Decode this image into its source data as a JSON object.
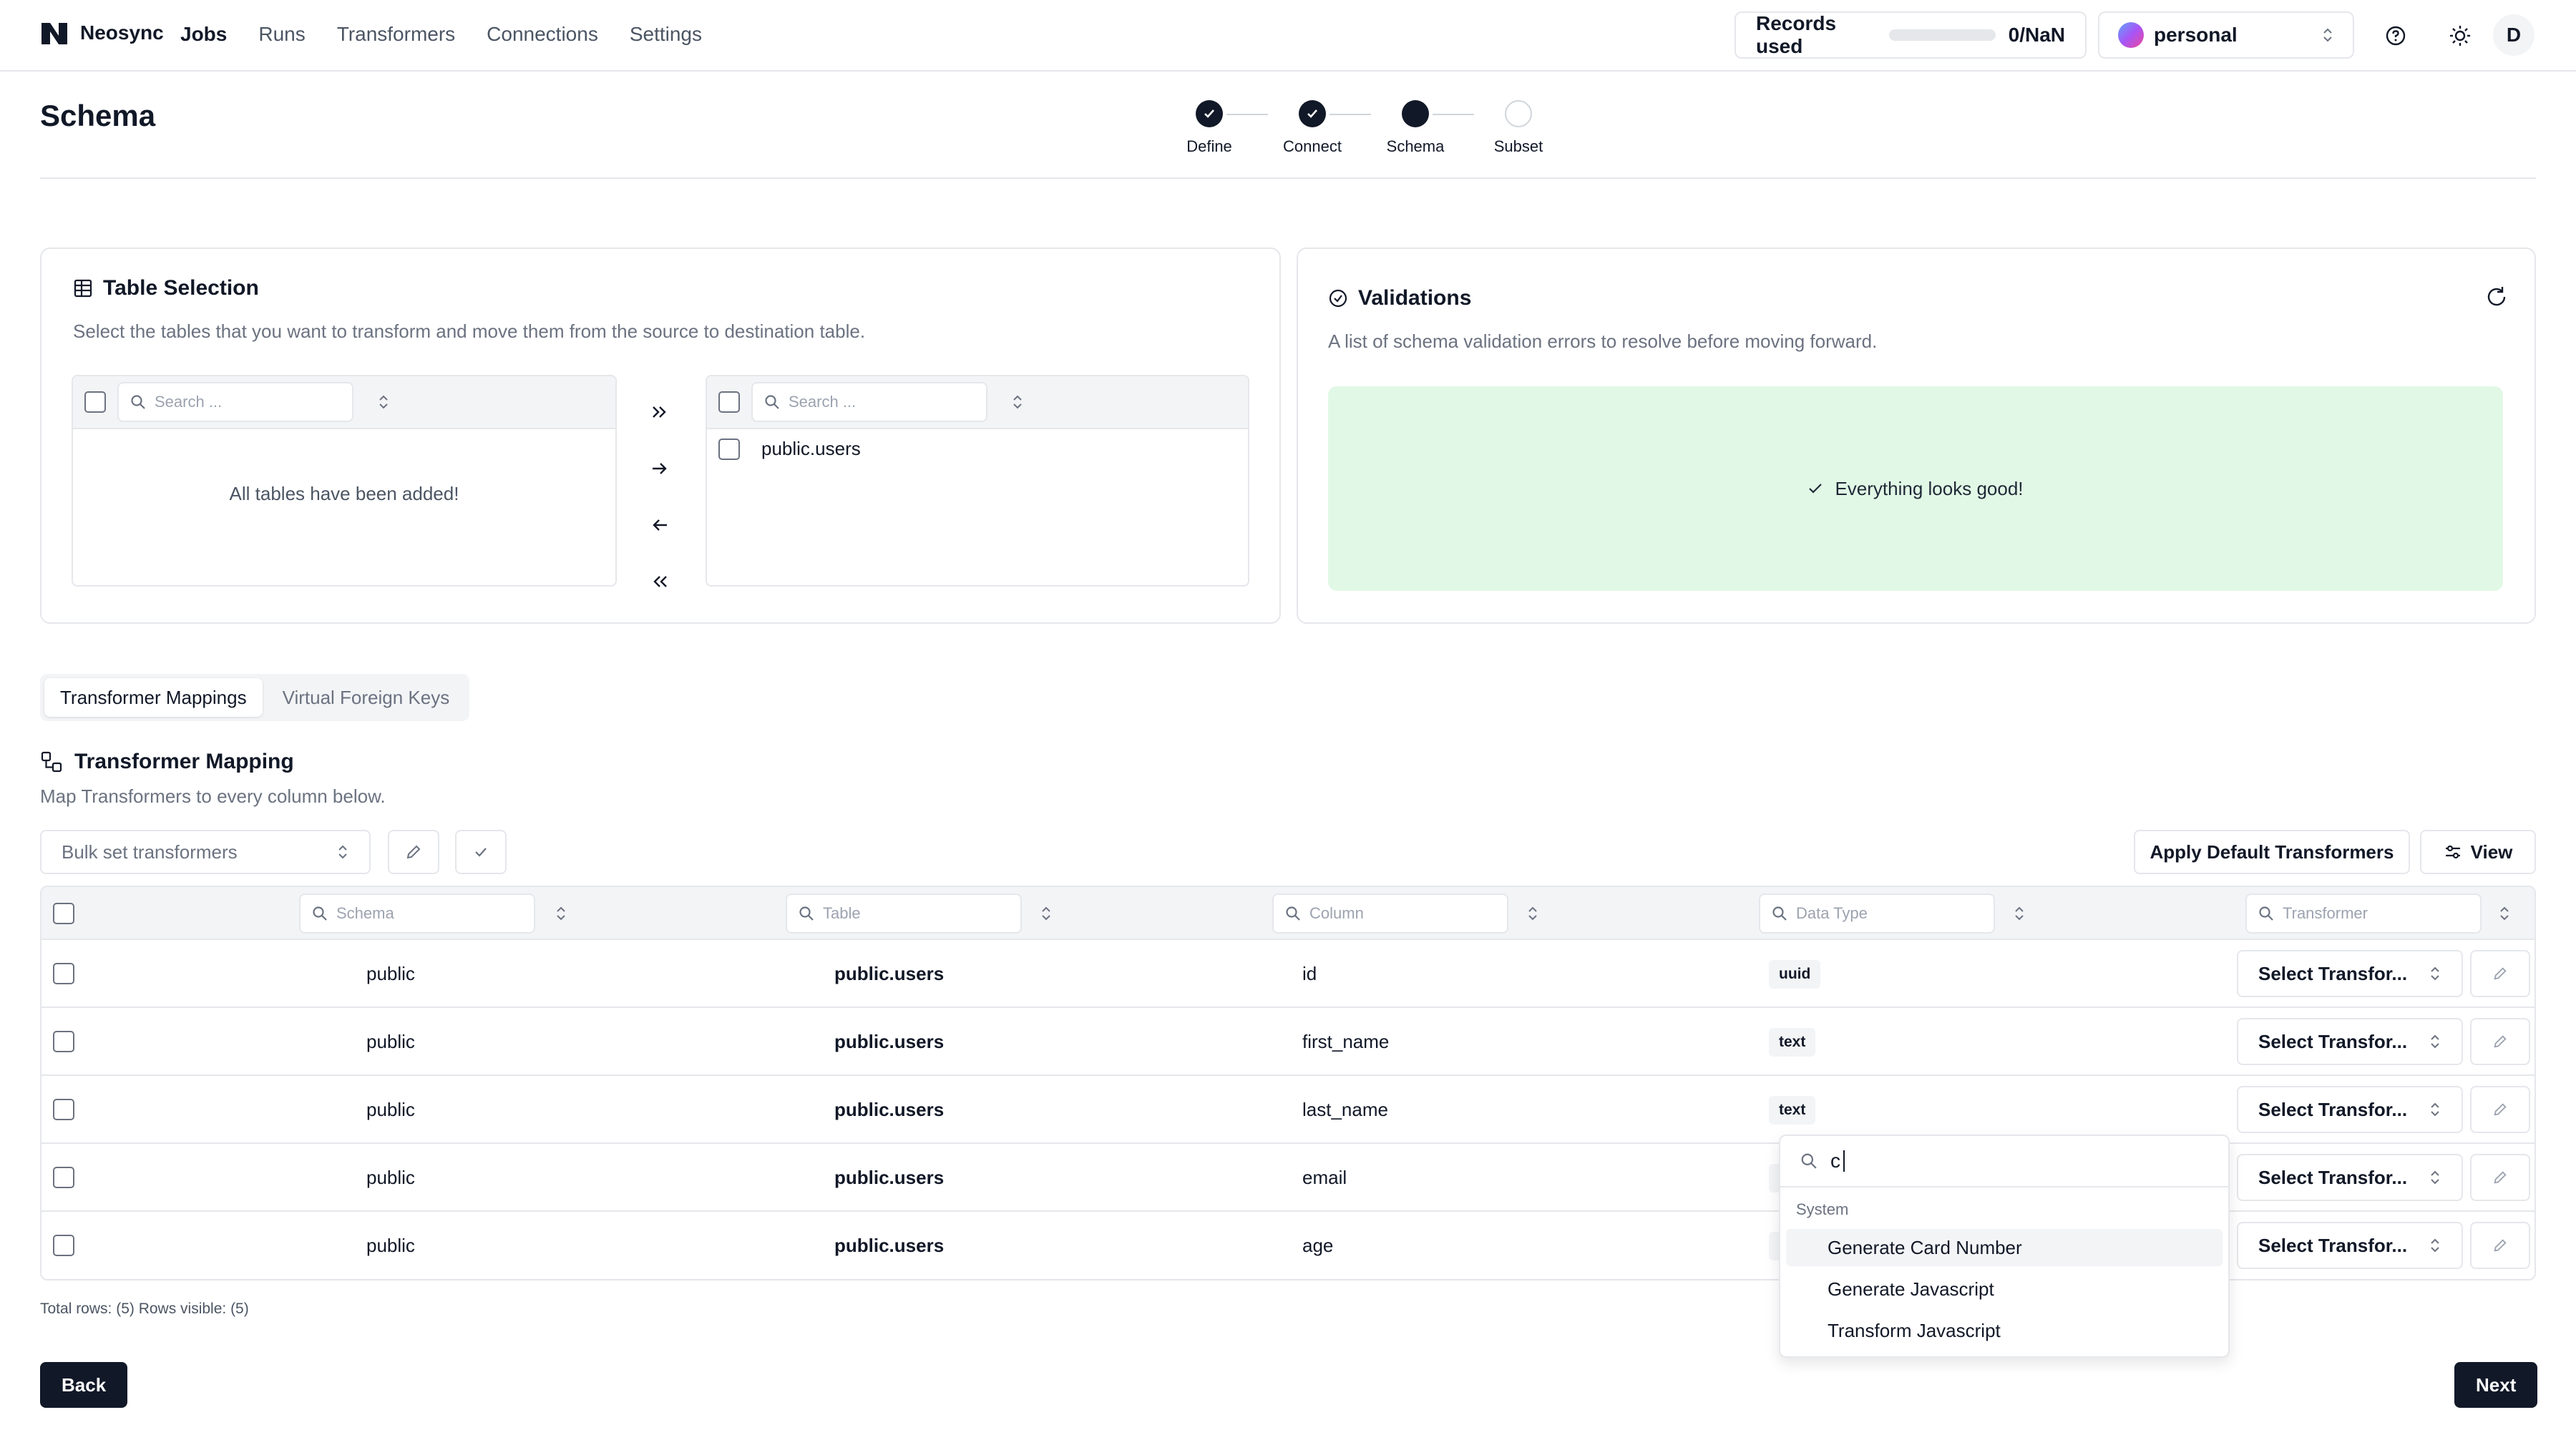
{
  "header": {
    "brand": "Neosync",
    "nav": [
      "Jobs",
      "Runs",
      "Transformers",
      "Connections",
      "Settings"
    ],
    "nav_active": "Jobs",
    "records_label": "Records used",
    "records_value": "0/NaN",
    "records_progress": 0,
    "account_name": "personal",
    "user_initial": "D"
  },
  "page": {
    "title": "Schema",
    "steps": [
      {
        "label": "Define",
        "state": "done"
      },
      {
        "label": "Connect",
        "state": "done"
      },
      {
        "label": "Schema",
        "state": "current"
      },
      {
        "label": "Subset",
        "state": "todo"
      }
    ]
  },
  "table_selection": {
    "title": "Table Selection",
    "description": "Select the tables that you want to transform and move them from the source to destination table.",
    "source_search_placeholder": "Search ...",
    "source_empty": "All tables have been added!",
    "dest_search_placeholder": "Search ...",
    "dest_items": [
      "public.users"
    ],
    "move_buttons": [
      "move-all-right",
      "move-right",
      "move-left",
      "move-all-left"
    ]
  },
  "validations": {
    "title": "Validations",
    "description": "A list of schema validation errors to resolve before moving forward.",
    "status": "Everything looks good!"
  },
  "tabs": [
    "Transformer Mappings",
    "Virtual Foreign Keys"
  ],
  "tab_active": "Transformer Mappings",
  "mapping": {
    "title": "Transformer Mapping",
    "description": "Map Transformers to every column below.",
    "bulk_placeholder": "Bulk set transformers",
    "apply_default_label": "Apply Default Transformers",
    "view_label": "View",
    "column_filters": [
      "Schema",
      "Table",
      "Column",
      "Data Type",
      "Transformer"
    ],
    "rows": [
      {
        "schema": "public",
        "table": "public.users",
        "column": "id",
        "type": "uuid",
        "transformer": "Select Transfor..."
      },
      {
        "schema": "public",
        "table": "public.users",
        "column": "first_name",
        "type": "text",
        "transformer": "Select Transfor..."
      },
      {
        "schema": "public",
        "table": "public.users",
        "column": "last_name",
        "type": "text",
        "transformer": "Select Transfor..."
      },
      {
        "schema": "public",
        "table": "public.users",
        "column": "email",
        "type": "text",
        "transformer": "Select Transfor..."
      },
      {
        "schema": "public",
        "table": "public.users",
        "column": "age",
        "type": "integer",
        "transformer": "Select Transfor..."
      }
    ],
    "footnote": "Total rows: (5) Rows visible: (5)"
  },
  "dropdown": {
    "search_value": "c",
    "group": "System",
    "items": [
      "Generate Card Number",
      "Generate Javascript",
      "Transform Javascript"
    ],
    "highlighted_index": 0
  },
  "footer": {
    "back_label": "Back",
    "next_label": "Next"
  }
}
